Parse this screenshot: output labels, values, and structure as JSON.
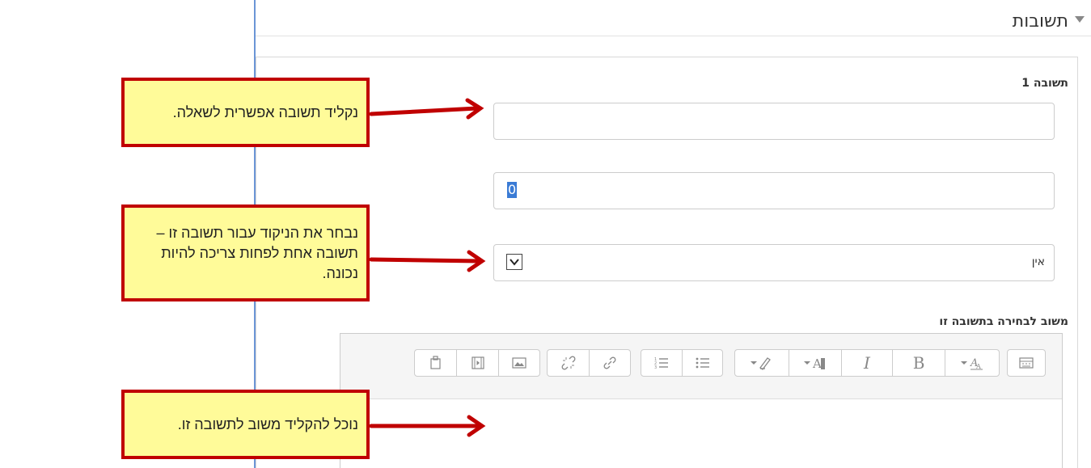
{
  "section": {
    "title": "תשובות",
    "toggle_icon": "caret-down-icon"
  },
  "answer": {
    "label": "תשובה 1",
    "input_value": "",
    "grade_input_value": "0",
    "grade_select_value": "אין"
  },
  "feedback": {
    "label": "משוב לבחירה בתשובה זו",
    "toolbar": {
      "groups": [
        [
          "insert-icon",
          "video-icon",
          "image-icon"
        ],
        [
          "unlink-icon",
          "link-icon"
        ],
        [
          "ordered-list-icon",
          "unordered-list-icon"
        ],
        [
          "clear-format-icon",
          "background-color-icon",
          "italic-icon",
          "bold-icon",
          "text-color-icon"
        ],
        [
          "toolbar-toggle-icon"
        ]
      ],
      "italic_label": "I",
      "bold_label": "B"
    },
    "editor_value": ""
  },
  "callouts": {
    "answer": "נקליד תשובה אפשרית לשאלה.",
    "grade": "נבחר את הניקוד עבור תשובה זו – תשובה אחת לפחות צריכה להיות נכונה.",
    "feedback": "נוכל להקליד משוב לתשובה זו."
  },
  "colors": {
    "callout_fill": "#fffb99",
    "callout_border": "#c00000",
    "panel_border": "#6b95d6"
  }
}
